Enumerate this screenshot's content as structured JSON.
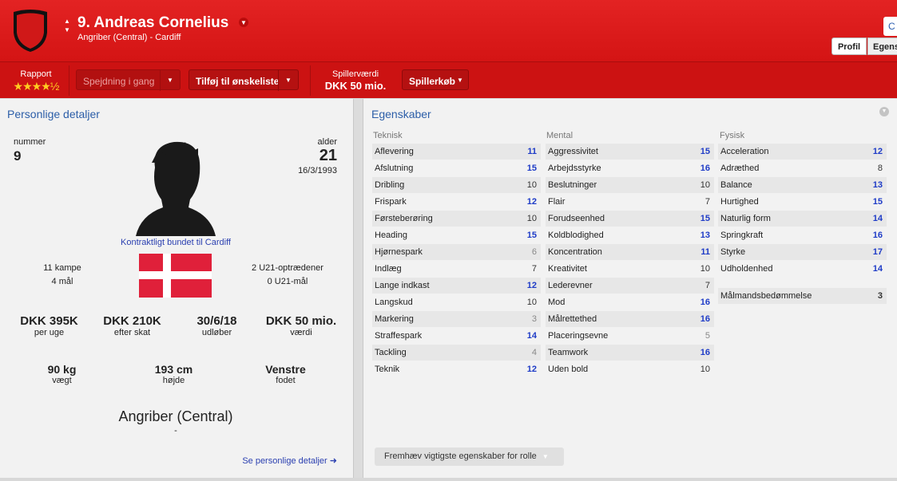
{
  "header": {
    "player_name": "9. Andreas Cornelius",
    "player_sub": "Angriber (Central) - Cardiff",
    "top_button": "C",
    "tabs": [
      "Profil",
      "Egenskaber"
    ]
  },
  "actions": {
    "report_label": "Rapport",
    "stars": "★★★★½",
    "scouting_label": "Spejdning i gang",
    "wishlist_label": "Tilføj til ønskeliste",
    "value_label": "Spillerværdi",
    "value": "DKK 50 mio.",
    "buy_label": "Spillerkøb"
  },
  "personal": {
    "title": "Personlige detaljer",
    "number_label": "nummer",
    "number": "9",
    "age_label": "alder",
    "age": "21",
    "dob": "16/3/1993",
    "contract": "Kontraktligt bundet til Cardiff",
    "caps": "11 kampe",
    "goals": "4 mål",
    "u21_caps": "2 U21-optrædener",
    "u21_goals": "0 U21-mål",
    "stats": [
      {
        "value": "DKK 395K",
        "label": "per uge"
      },
      {
        "value": "DKK 210K",
        "label": "efter skat"
      },
      {
        "value": "30/6/18",
        "label": "udløber"
      },
      {
        "value": "DKK 50 mio.",
        "label": "værdi"
      }
    ],
    "physical": [
      {
        "value": "90 kg",
        "label": "vægt"
      },
      {
        "value": "193 cm",
        "label": "højde"
      },
      {
        "value": "Venstre",
        "label": "fodet"
      }
    ],
    "position": "Angriber (Central)",
    "position_sub": "-",
    "more_link": "Se personlige detaljer ➜",
    "flag_colors": {
      "red": "#e0203a",
      "white": "#ffffff"
    }
  },
  "attributes": {
    "title": "Egenskaber",
    "technical": {
      "header": "Teknisk",
      "items": [
        {
          "name": "Aflevering",
          "value": "11"
        },
        {
          "name": "Afslutning",
          "value": "15"
        },
        {
          "name": "Dribling",
          "value": "10"
        },
        {
          "name": "Frispark",
          "value": "12"
        },
        {
          "name": "Førsteberøring",
          "value": "10"
        },
        {
          "name": "Heading",
          "value": "15"
        },
        {
          "name": "Hjørnespark",
          "value": "6"
        },
        {
          "name": "Indlæg",
          "value": "7"
        },
        {
          "name": "Lange indkast",
          "value": "12"
        },
        {
          "name": "Langskud",
          "value": "10"
        },
        {
          "name": "Markering",
          "value": "3"
        },
        {
          "name": "Straffespark",
          "value": "14"
        },
        {
          "name": "Tackling",
          "value": "4"
        },
        {
          "name": "Teknik",
          "value": "12"
        }
      ]
    },
    "mental": {
      "header": "Mental",
      "items": [
        {
          "name": "Aggressivitet",
          "value": "15"
        },
        {
          "name": "Arbejdsstyrke",
          "value": "16"
        },
        {
          "name": "Beslutninger",
          "value": "10"
        },
        {
          "name": "Flair",
          "value": "7"
        },
        {
          "name": "Forudseenhed",
          "value": "15"
        },
        {
          "name": "Koldblodighed",
          "value": "13"
        },
        {
          "name": "Koncentration",
          "value": "11"
        },
        {
          "name": "Kreativitet",
          "value": "10"
        },
        {
          "name": "Lederevner",
          "value": "7"
        },
        {
          "name": "Mod",
          "value": "16"
        },
        {
          "name": "Målrettethed",
          "value": "16"
        },
        {
          "name": "Placeringsevne",
          "value": "5"
        },
        {
          "name": "Teamwork",
          "value": "16"
        },
        {
          "name": "Uden bold",
          "value": "10"
        }
      ]
    },
    "physical": {
      "header": "Fysisk",
      "items": [
        {
          "name": "Acceleration",
          "value": "12"
        },
        {
          "name": "Adræthed",
          "value": "8"
        },
        {
          "name": "Balance",
          "value": "13"
        },
        {
          "name": "Hurtighed",
          "value": "15"
        },
        {
          "name": "Naturlig form",
          "value": "14"
        },
        {
          "name": "Springkraft",
          "value": "16"
        },
        {
          "name": "Styrke",
          "value": "17"
        },
        {
          "name": "Udholdenhed",
          "value": "14"
        }
      ]
    },
    "gk_rating": {
      "name": "Målmandsbedømmelse",
      "value": "3"
    },
    "highlight_button": "Fremhæv vigtigste egenskaber for rolle"
  }
}
